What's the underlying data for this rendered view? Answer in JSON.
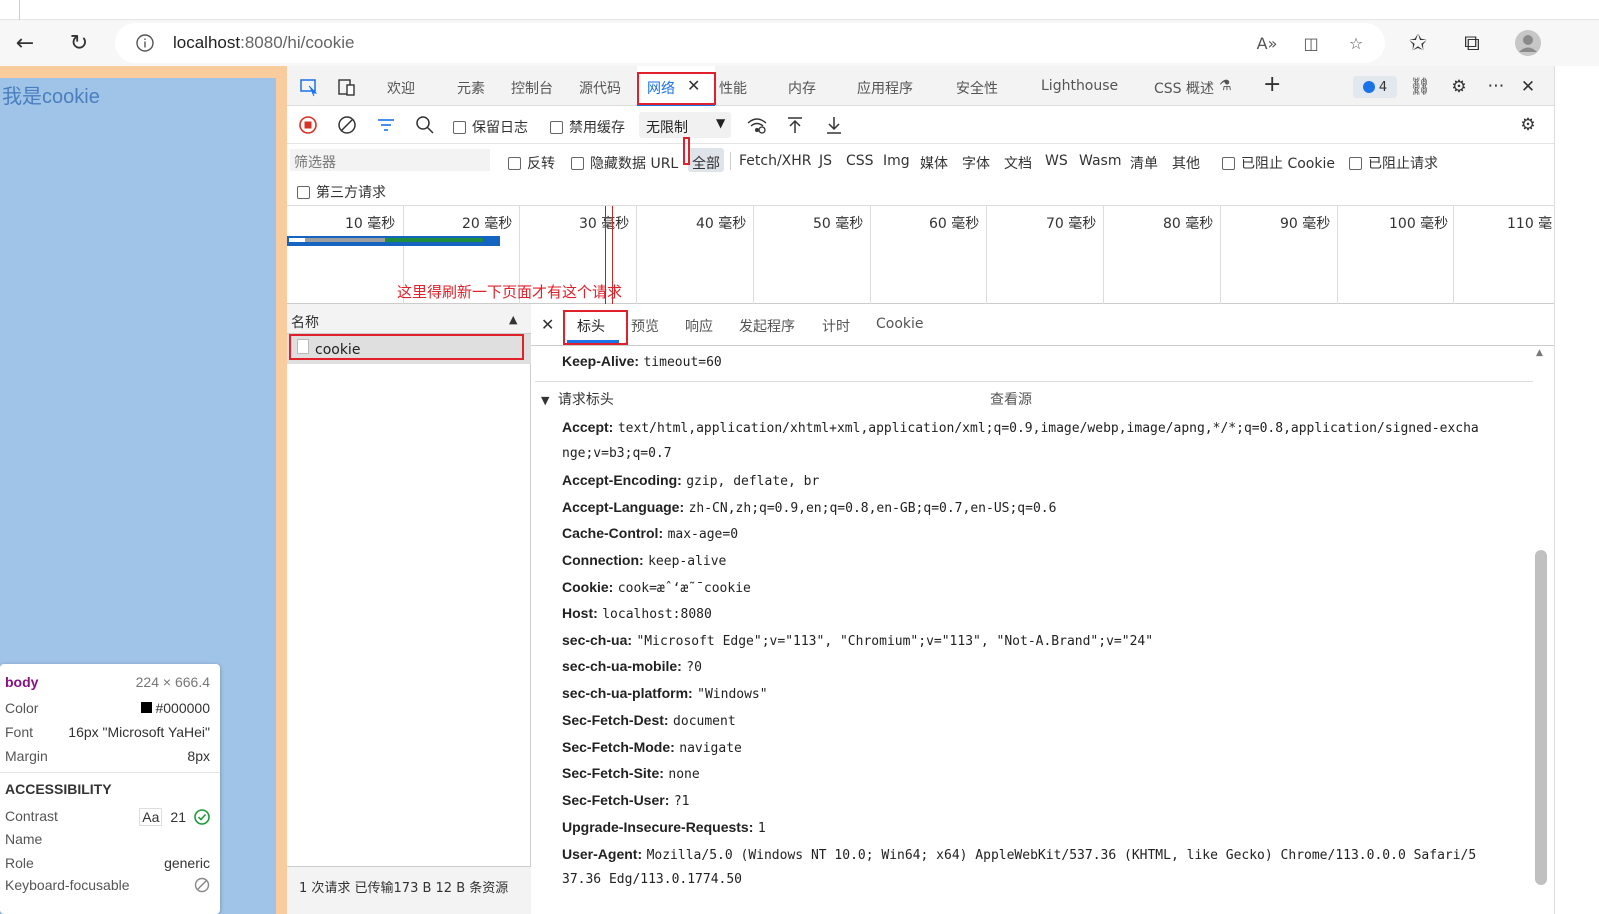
{
  "browser": {
    "url_host": "localhost",
    "url_rest": ":8080/hi/cookie"
  },
  "page": {
    "text": "我是cookie"
  },
  "tooltip": {
    "tag": "body",
    "size": "224 × 666.4",
    "color_label": "Color",
    "color_value": "#000000",
    "font_label": "Font",
    "font_value": "16px \"Microsoft YaHei\"",
    "margin_label": "Margin",
    "margin_value": "8px",
    "accessibility_title": "ACCESSIBILITY",
    "contrast_label": "Contrast",
    "contrast_aa": "Aa",
    "contrast_value": "21",
    "name_label": "Name",
    "role_label": "Role",
    "role_value": "generic",
    "keyboard_label": "Keyboard-focusable"
  },
  "devtools": {
    "tabs": [
      "欢迎",
      "元素",
      "控制台",
      "源代码",
      "网络",
      "性能",
      "内存",
      "应用程序",
      "安全性",
      "Lighthouse",
      "CSS 概述"
    ],
    "issues_count": "4",
    "toolbar": {
      "preserve_log": "保留日志",
      "disable_cache": "禁用缓存",
      "throttle": "无限制"
    },
    "filter": {
      "placeholder": "筛选器",
      "invert": "反转",
      "hide_data_urls": "隐藏数据 URL",
      "types": [
        "全部",
        "Fetch/XHR",
        "JS",
        "CSS",
        "Img",
        "媒体",
        "字体",
        "文档",
        "WS",
        "Wasm",
        "清单",
        "其他"
      ],
      "blocked_cookies": "已阻止 Cookie",
      "blocked_requests": "已阻止请求",
      "third_party": "第三方请求"
    },
    "timeline_ticks": [
      "10 毫秒",
      "20 毫秒",
      "30 毫秒",
      "40 毫秒",
      "50 毫秒",
      "60 毫秒",
      "70 毫秒",
      "80 毫秒",
      "90 毫秒",
      "100 毫秒",
      "110 毫"
    ],
    "annotation": "这里得刷新一下页面才有这个请求",
    "requests": {
      "column_name": "名称",
      "rows": [
        "cookie"
      ],
      "status": "1 次请求  已传输173 B  12 B 条资源"
    },
    "detail_tabs": [
      "标头",
      "预览",
      "响应",
      "发起程序",
      "计时",
      "Cookie"
    ],
    "keep_alive": {
      "name": "Keep-Alive:",
      "value": "timeout=60"
    },
    "request_headers_title": "请求标头",
    "view_source": "查看源",
    "headers": [
      {
        "name": "Accept:",
        "value": "text/html,application/xhtml+xml,application/xml;q=0.9,image/webp,image/apng,*/*;q=0.8,application/signed-excha"
      },
      {
        "name": "",
        "value": "nge;v=b3;q=0.7"
      },
      {
        "name": "Accept-Encoding:",
        "value": "gzip, deflate, br"
      },
      {
        "name": "Accept-Language:",
        "value": "zh-CN,zh;q=0.9,en;q=0.8,en-GB;q=0.7,en-US;q=0.6"
      },
      {
        "name": "Cache-Control:",
        "value": "max-age=0"
      },
      {
        "name": "Connection:",
        "value": "keep-alive"
      },
      {
        "name": "Cookie:",
        "value": "cook=æˆ‘æ˜¯cookie"
      },
      {
        "name": "Host:",
        "value": "localhost:8080"
      },
      {
        "name": "sec-ch-ua:",
        "value": "\"Microsoft Edge\";v=\"113\", \"Chromium\";v=\"113\", \"Not-A.Brand\";v=\"24\""
      },
      {
        "name": "sec-ch-ua-mobile:",
        "value": "?0"
      },
      {
        "name": "sec-ch-ua-platform:",
        "value": "\"Windows\""
      },
      {
        "name": "Sec-Fetch-Dest:",
        "value": "document"
      },
      {
        "name": "Sec-Fetch-Mode:",
        "value": "navigate"
      },
      {
        "name": "Sec-Fetch-Site:",
        "value": "none"
      },
      {
        "name": "Sec-Fetch-User:",
        "value": "?1"
      },
      {
        "name": "Upgrade-Insecure-Requests:",
        "value": "1"
      },
      {
        "name": "User-Agent:",
        "value": "Mozilla/5.0 (Windows NT 10.0; Win64; x64) AppleWebKit/537.36 (KHTML, like Gecko) Chrome/113.0.0.0 Safari/5"
      },
      {
        "name": "",
        "value": "37.36 Edg/113.0.1774.50"
      }
    ]
  },
  "colors": {
    "annotation_red": "#e0202a",
    "active_tab_blue": "#1a73e8",
    "page_blue": "#a0c4e8",
    "page_orange": "#f9cc9d"
  }
}
